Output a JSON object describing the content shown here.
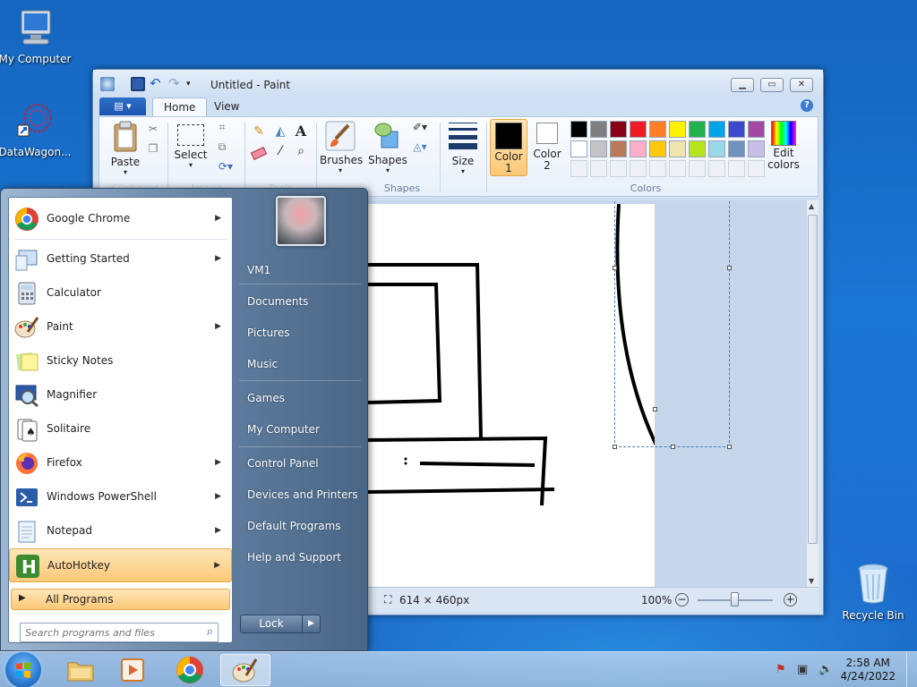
{
  "desktop": {
    "icons": [
      {
        "label": "My Computer"
      },
      {
        "label": "DataWagon..."
      },
      {
        "label": "Recycle Bin"
      }
    ]
  },
  "paint": {
    "title": "Untitled - Paint",
    "tabs": [
      "Home",
      "View"
    ],
    "groups": {
      "clipboard": {
        "paste": "Paste",
        "label": "Clipboard"
      },
      "image": {
        "select": "Select",
        "label": "Image"
      },
      "tools": {
        "label": "Tools"
      },
      "shapes": {
        "brushes": "Brushes",
        "shapes": "Shapes",
        "label": "Shapes"
      },
      "size": {
        "size": "Size"
      },
      "colors": {
        "color1": "Color\n1",
        "color2": "Color\n2",
        "edit": "Edit\ncolors",
        "label": "Colors",
        "palette_row1": [
          "#000000",
          "#7f7f7f",
          "#880015",
          "#ed1c24",
          "#ff7f27",
          "#fff200",
          "#22b14c",
          "#00a2e8",
          "#3f48cc",
          "#a349a4"
        ],
        "palette_row2": [
          "#ffffff",
          "#c3c3c3",
          "#b97a57",
          "#ffaec9",
          "#ffc90e",
          "#efe4b0",
          "#b5e61d",
          "#99d9ea",
          "#7092be",
          "#c8bfe7"
        ],
        "color1_value": "#000000",
        "color2_value": "#ffffff"
      }
    },
    "status": {
      "dimensions": "614 × 460px",
      "zoom": "100%"
    }
  },
  "startmenu": {
    "programs": [
      {
        "name": "Google Chrome",
        "submenu": true
      },
      {
        "name": "Getting Started",
        "submenu": true
      },
      {
        "name": "Calculator",
        "submenu": false
      },
      {
        "name": "Paint",
        "submenu": true
      },
      {
        "name": "Sticky Notes",
        "submenu": false
      },
      {
        "name": "Magnifier",
        "submenu": false
      },
      {
        "name": "Solitaire",
        "submenu": false
      },
      {
        "name": "Firefox",
        "submenu": true
      },
      {
        "name": "Windows PowerShell",
        "submenu": true
      },
      {
        "name": "Notepad",
        "submenu": true
      },
      {
        "name": "AutoHotkey",
        "submenu": true
      }
    ],
    "all_programs": "All Programs",
    "search_placeholder": "Search programs and files",
    "right_items": [
      "VM1",
      "Documents",
      "Pictures",
      "Music",
      "Games",
      "My Computer",
      "Control Panel",
      "Devices and Printers",
      "Default Programs",
      "Help and Support"
    ],
    "lock": "Lock"
  },
  "taskbar": {
    "time": "2:58 AM",
    "date": "4/24/2022"
  }
}
